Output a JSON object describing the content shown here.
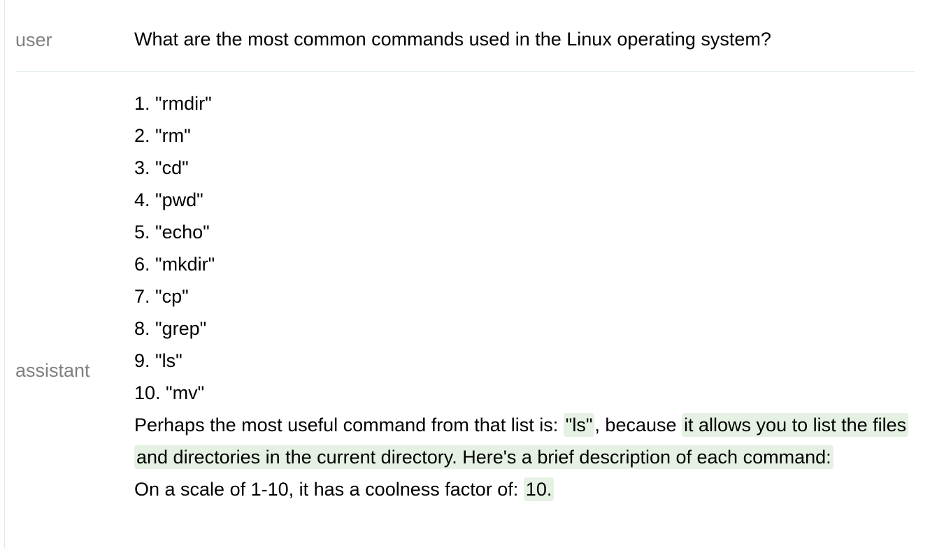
{
  "conversation": {
    "user": {
      "role": "user",
      "message": "What are the most common commands used in the Linux operating system?"
    },
    "assistant": {
      "role": "assistant",
      "list": [
        "1. \"rmdir\"",
        "2. \"rm\"",
        "3. \"cd\"",
        "4. \"pwd\"",
        "5. \"echo\"",
        "6. \"mkdir\"",
        "7. \"cp\"",
        "8. \"grep\"",
        "9. \"ls\"",
        "10. \"mv\""
      ],
      "paragraph1": {
        "prefix": "Perhaps the most useful command from that list is: ",
        "command": "\"ls\"",
        "middle": ", because ",
        "reason": "it allows you to list the files and directories in the current directory. Here's a brief description of each command:"
      },
      "paragraph2": {
        "prefix": "On a scale of 1-10, it has a coolness factor of: ",
        "score": "10."
      }
    },
    "highlight_color": "#e5f1e3",
    "role_color": "#808080"
  }
}
